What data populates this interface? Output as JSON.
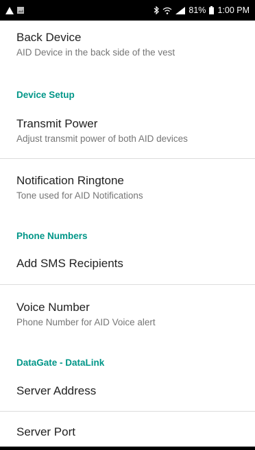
{
  "status_bar": {
    "battery_percent": "81%",
    "time": "1:00 PM",
    "left_icons": [
      "alert-triangle-icon",
      "image-icon"
    ],
    "right_icons": [
      "bluetooth-icon",
      "wifi-icon",
      "signal-icon",
      "battery-icon"
    ]
  },
  "settings": {
    "back_device": {
      "title": "Back Device",
      "summary": "AID Device in the back side of the vest"
    },
    "device_setup": {
      "header": "Device Setup",
      "transmit_power": {
        "title": "Transmit Power",
        "summary": "Adjust transmit power of both AID devices"
      },
      "notification_ringtone": {
        "title": "Notification Ringtone",
        "summary": "Tone used for AID Notifications"
      }
    },
    "phone_numbers": {
      "header": "Phone Numbers",
      "add_sms": {
        "title": "Add SMS Recipients"
      },
      "voice_number": {
        "title": "Voice Number",
        "summary": "Phone Number for AID Voice alert"
      }
    },
    "datagate": {
      "header": "DataGate - DataLink",
      "server_address": {
        "title": "Server Address"
      },
      "server_port": {
        "title": "Server Port"
      }
    }
  },
  "colors": {
    "accent": "#009688",
    "status_bar": "#000000"
  }
}
